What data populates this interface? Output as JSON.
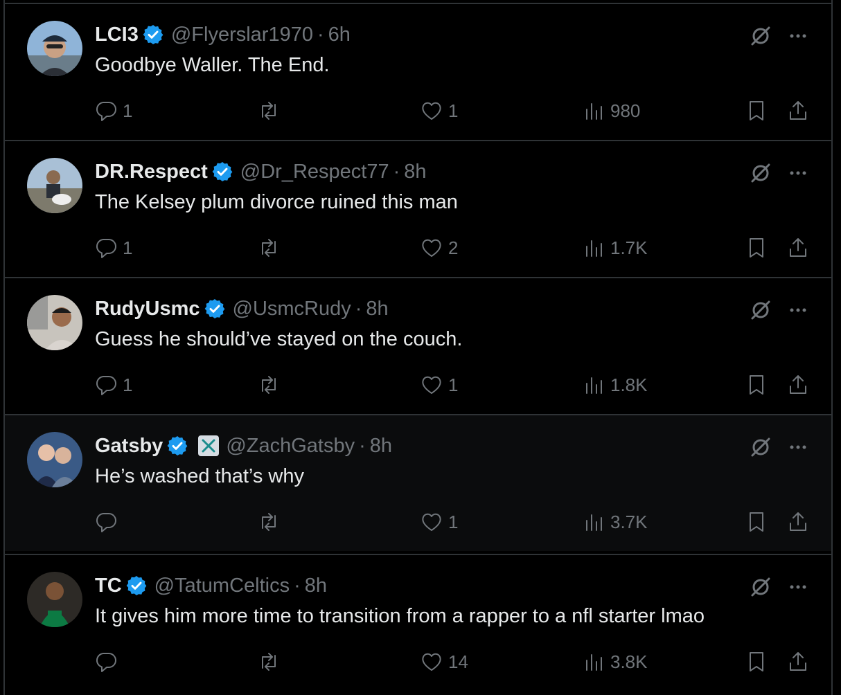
{
  "colors": {
    "background": "#000000",
    "text": "#e7e9ea",
    "muted": "#71767b",
    "verified": "#1d9bf0",
    "divider": "#2f3336"
  },
  "tweets": [
    {
      "name": "LCI3",
      "handle": "@Flyerslar1970",
      "separator": "·",
      "time": "6h",
      "text": "Goodbye Waller. The End.",
      "replies": "1",
      "retweets": "",
      "likes": "1",
      "views": "980",
      "avatar_icon": "avatar-photo"
    },
    {
      "name": "DR.Respect",
      "handle": "@Dr_Respect77",
      "separator": "·",
      "time": "8h",
      "text": "The Kelsey plum divorce ruined this man",
      "replies": "1",
      "retweets": "",
      "likes": "2",
      "views": "1.7K",
      "avatar_icon": "avatar-photo"
    },
    {
      "name": "RudyUsmc",
      "handle": "@UsmcRudy",
      "separator": "·",
      "time": "8h",
      "text": "Guess he should’ve stayed on the couch.",
      "replies": "1",
      "retweets": "",
      "likes": "1",
      "views": "1.8K",
      "avatar_icon": "avatar-photo"
    },
    {
      "name": "Gatsby",
      "handle": "@ZachGatsby",
      "separator": "·",
      "time": "8h",
      "text": "He’s washed that’s why",
      "replies": "",
      "retweets": "",
      "likes": "1",
      "views": "3.7K",
      "avatar_icon": "avatar-photo",
      "affiliate_badge": "x-logo-icon"
    },
    {
      "name": "TC",
      "handle": "@TatumCeltics",
      "separator": "·",
      "time": "8h",
      "text": "It gives him more time to transition from a rapper to a nfl starter lmao",
      "replies": "",
      "retweets": "",
      "likes": "14",
      "views": "3.8K",
      "avatar_icon": "avatar-photo"
    }
  ]
}
